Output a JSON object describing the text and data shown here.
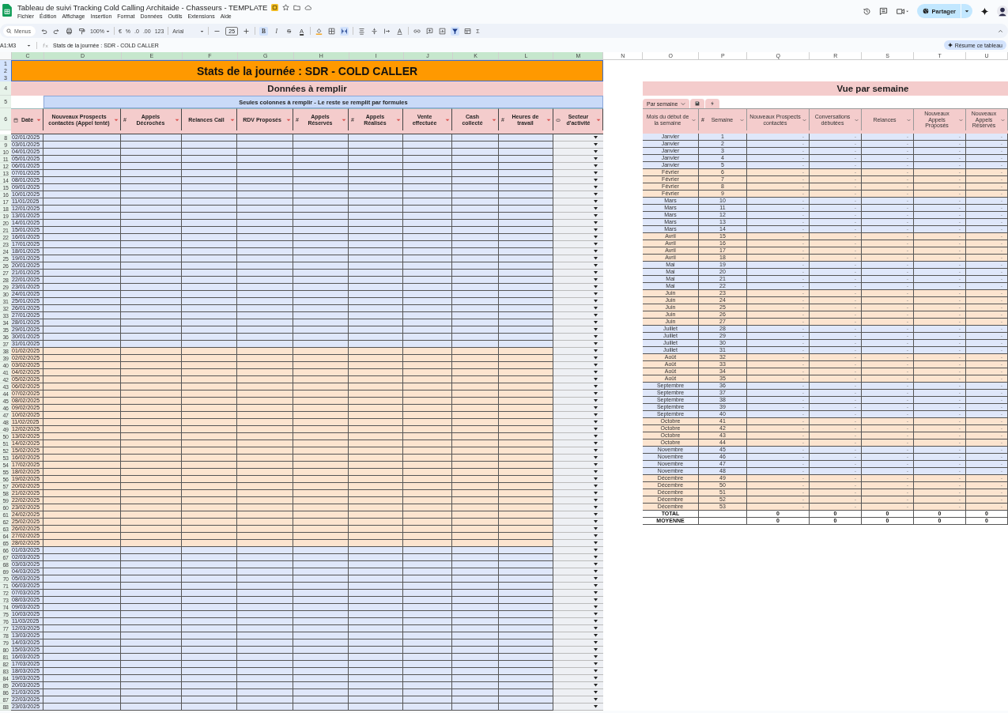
{
  "app": {
    "title": "Tableau de suivi Tracking Cold Calling Architaide - Chasseurs - TEMPLATE",
    "menus": [
      "Fichier",
      "Édition",
      "Affichage",
      "Insertion",
      "Format",
      "Données",
      "Outils",
      "Extensions",
      "Aide"
    ],
    "share": "Partager",
    "ai_button": "Résume ce tableau"
  },
  "toolbar": {
    "search": "Menus",
    "zoom": "100%",
    "currency": "€",
    "percent": "%",
    "decrease_decimals": ".0",
    "increase_decimals": ".00",
    "number_format": "123",
    "font": "Arial",
    "font_size": "25",
    "format_buttons": [
      {
        "label": "B",
        "kind": "bold",
        "on": true
      },
      {
        "label": "I",
        "kind": "italic",
        "on": false
      },
      {
        "label": "S",
        "kind": "strike",
        "on": false
      },
      {
        "label": "A",
        "kind": "color",
        "on": false
      }
    ],
    "merge_on": true,
    "filter_on": true,
    "functions": "Σ"
  },
  "formula_bar": {
    "name_box": "A1:M3",
    "formula": "Stats de la journée : SDR - COLD CALLER"
  },
  "columns": [
    {
      "label": "C",
      "selected": true
    },
    {
      "label": "D",
      "selected": true
    },
    {
      "label": "E",
      "selected": true
    },
    {
      "label": "F",
      "selected": true
    },
    {
      "label": "G",
      "selected": true
    },
    {
      "label": "H",
      "selected": true
    },
    {
      "label": "I",
      "selected": true
    },
    {
      "label": "J",
      "selected": true
    },
    {
      "label": "K",
      "selected": true
    },
    {
      "label": "L",
      "selected": true
    },
    {
      "label": "M",
      "selected": true
    },
    {
      "label": "N",
      "selected": false
    },
    {
      "label": "O",
      "selected": false
    },
    {
      "label": "P",
      "selected": false
    },
    {
      "label": "Q",
      "selected": false
    },
    {
      "label": "R",
      "selected": false
    },
    {
      "label": "S",
      "selected": false
    },
    {
      "label": "T",
      "selected": false
    },
    {
      "label": "U",
      "selected": false
    }
  ],
  "header_rows": [
    {
      "label": "1",
      "selected": true
    },
    {
      "label": "2",
      "selected": true
    },
    {
      "label": "3",
      "selected": true
    },
    {
      "label": "4",
      "selected": false
    },
    {
      "label": "5",
      "selected": false
    },
    {
      "label": "6",
      "selected": false
    }
  ],
  "left": {
    "title": "Stats de la journée : SDR - COLD CALLER",
    "subtitle": "Données à remplir",
    "note": "Seules colonnes à remplir - Le reste se remplit par formules",
    "headers": [
      {
        "label": "Date",
        "kind": "date"
      },
      {
        "label": "Nouveaux Prospects contactés (Appel tenté)",
        "kind": "text"
      },
      {
        "label": "Appels Décrochés",
        "kind": "number",
        "prefix": "#"
      },
      {
        "label": "Relances Call",
        "kind": "text"
      },
      {
        "label": "RDV Proposés",
        "kind": "text"
      },
      {
        "label": "Appels Réservés",
        "kind": "number",
        "prefix": "#"
      },
      {
        "label": "Appels Réalisés",
        "kind": "number",
        "prefix": "#"
      },
      {
        "label": "Vente effectuée",
        "kind": "text"
      },
      {
        "label": "Cash collecté",
        "kind": "text"
      },
      {
        "label": "Heures de travail",
        "kind": "number",
        "prefix": "#"
      },
      {
        "label": "Secteur d'activité",
        "kind": "dropdown"
      }
    ],
    "groups": [
      {
        "color": "#dfe7fa",
        "rows": [
          {
            "row": "8",
            "date": "02/01/2025"
          },
          {
            "row": "9",
            "date": "03/01/2025"
          },
          {
            "row": "10",
            "date": "04/01/2025"
          },
          {
            "row": "11",
            "date": "05/01/2025"
          },
          {
            "row": "12",
            "date": "06/01/2025"
          },
          {
            "row": "13",
            "date": "07/01/2025"
          },
          {
            "row": "14",
            "date": "08/01/2025"
          },
          {
            "row": "15",
            "date": "09/01/2025"
          },
          {
            "row": "16",
            "date": "10/01/2025"
          },
          {
            "row": "17",
            "date": "11/01/2025"
          },
          {
            "row": "18",
            "date": "12/01/2025"
          },
          {
            "row": "19",
            "date": "13/01/2025"
          },
          {
            "row": "20",
            "date": "14/01/2025"
          },
          {
            "row": "21",
            "date": "15/01/2025"
          },
          {
            "row": "22",
            "date": "16/01/2025"
          },
          {
            "row": "23",
            "date": "17/01/2025"
          },
          {
            "row": "24",
            "date": "18/01/2025"
          },
          {
            "row": "25",
            "date": "19/01/2025"
          },
          {
            "row": "26",
            "date": "20/01/2025"
          },
          {
            "row": "27",
            "date": "21/01/2025"
          },
          {
            "row": "28",
            "date": "22/01/2025"
          },
          {
            "row": "29",
            "date": "23/01/2025"
          },
          {
            "row": "30",
            "date": "24/01/2025"
          },
          {
            "row": "31",
            "date": "25/01/2025"
          },
          {
            "row": "32",
            "date": "26/01/2025"
          },
          {
            "row": "33",
            "date": "27/01/2025"
          },
          {
            "row": "34",
            "date": "28/01/2025"
          },
          {
            "row": "35",
            "date": "29/01/2025"
          },
          {
            "row": "36",
            "date": "30/01/2025"
          },
          {
            "row": "37",
            "date": "31/01/2025"
          }
        ]
      },
      {
        "color": "#fce4cf",
        "rows": [
          {
            "row": "38",
            "date": "01/02/2025"
          },
          {
            "row": "39",
            "date": "02/02/2025"
          },
          {
            "row": "40",
            "date": "03/02/2025"
          },
          {
            "row": "41",
            "date": "04/02/2025"
          },
          {
            "row": "42",
            "date": "05/02/2025"
          },
          {
            "row": "43",
            "date": "06/02/2025"
          },
          {
            "row": "44",
            "date": "07/02/2025"
          },
          {
            "row": "45",
            "date": "08/02/2025"
          },
          {
            "row": "46",
            "date": "09/02/2025"
          },
          {
            "row": "47",
            "date": "10/02/2025"
          },
          {
            "row": "48",
            "date": "11/02/2025"
          },
          {
            "row": "49",
            "date": "12/02/2025"
          },
          {
            "row": "50",
            "date": "13/02/2025"
          },
          {
            "row": "51",
            "date": "14/02/2025"
          },
          {
            "row": "52",
            "date": "15/02/2025"
          },
          {
            "row": "53",
            "date": "16/02/2025"
          },
          {
            "row": "54",
            "date": "17/02/2025"
          },
          {
            "row": "55",
            "date": "18/02/2025"
          },
          {
            "row": "56",
            "date": "19/02/2025"
          },
          {
            "row": "57",
            "date": "20/02/2025"
          },
          {
            "row": "58",
            "date": "21/02/2025"
          },
          {
            "row": "59",
            "date": "22/02/2025"
          },
          {
            "row": "60",
            "date": "23/02/2025"
          },
          {
            "row": "61",
            "date": "24/02/2025"
          },
          {
            "row": "62",
            "date": "25/02/2025"
          },
          {
            "row": "63",
            "date": "26/02/2025"
          },
          {
            "row": "64",
            "date": "27/02/2025"
          },
          {
            "row": "65",
            "date": "28/02/2025"
          }
        ]
      },
      {
        "color": "#dfe7fa",
        "rows": [
          {
            "row": "66",
            "date": "01/03/2025"
          },
          {
            "row": "67",
            "date": "02/03/2025"
          },
          {
            "row": "68",
            "date": "03/03/2025"
          },
          {
            "row": "69",
            "date": "04/03/2025"
          },
          {
            "row": "70",
            "date": "05/03/2025"
          },
          {
            "row": "71",
            "date": "06/03/2025"
          },
          {
            "row": "72",
            "date": "07/03/2025"
          },
          {
            "row": "73",
            "date": "08/03/2025"
          },
          {
            "row": "74",
            "date": "09/03/2025"
          },
          {
            "row": "75",
            "date": "10/03/2025"
          },
          {
            "row": "76",
            "date": "11/03/2025"
          },
          {
            "row": "77",
            "date": "12/03/2025"
          },
          {
            "row": "78",
            "date": "13/03/2025"
          },
          {
            "row": "79",
            "date": "14/03/2025"
          },
          {
            "row": "80",
            "date": "15/03/2025"
          },
          {
            "row": "81",
            "date": "16/03/2025"
          },
          {
            "row": "82",
            "date": "17/03/2025"
          },
          {
            "row": "83",
            "date": "18/03/2025"
          },
          {
            "row": "84",
            "date": "19/03/2025"
          },
          {
            "row": "85",
            "date": "20/03/2025"
          },
          {
            "row": "86",
            "date": "21/03/2025"
          },
          {
            "row": "87",
            "date": "22/03/2025"
          },
          {
            "row": "88",
            "date": "23/03/2025"
          }
        ]
      }
    ]
  },
  "right": {
    "title": "Vue par semaine",
    "tab": "Par semaine",
    "headers": [
      {
        "label": "Mois du début de la semaine",
        "kind": "text"
      },
      {
        "label": "Semaine",
        "kind": "number",
        "prefix": "#"
      },
      {
        "label": "Nouveaux Prospects contactés",
        "kind": "text"
      },
      {
        "label": "Conversations débutées",
        "kind": "text"
      },
      {
        "label": "Relances",
        "kind": "text"
      },
      {
        "label": "Nouveaux Appels Proposés",
        "kind": "text"
      },
      {
        "label": "Nouveaux Appels Réservés",
        "kind": "text"
      }
    ],
    "groups": [
      {
        "color": "#dfe7fa",
        "rows": [
          {
            "month": "Janvier",
            "week": "1",
            "values": [
              "-",
              "-",
              "-",
              "-",
              "-"
            ]
          },
          {
            "month": "Janvier",
            "week": "2",
            "values": [
              "-",
              "-",
              "-",
              "-",
              "-"
            ]
          },
          {
            "month": "Janvier",
            "week": "3",
            "values": [
              "-",
              "-",
              "-",
              "-",
              "-"
            ]
          },
          {
            "month": "Janvier",
            "week": "4",
            "values": [
              "-",
              "-",
              "-",
              "-",
              "-"
            ]
          },
          {
            "month": "Janvier",
            "week": "5",
            "values": [
              "-",
              "-",
              "-",
              "-",
              "-"
            ]
          }
        ]
      },
      {
        "color": "#fce4cf",
        "rows": [
          {
            "month": "Février",
            "week": "6",
            "values": [
              "-",
              "-",
              "-",
              "-",
              "-"
            ]
          },
          {
            "month": "Février",
            "week": "7",
            "values": [
              "-",
              "-",
              "-",
              "-",
              "-"
            ]
          },
          {
            "month": "Février",
            "week": "8",
            "values": [
              "-",
              "-",
              "-",
              "-",
              "-"
            ]
          },
          {
            "month": "Février",
            "week": "9",
            "values": [
              "-",
              "-",
              "-",
              "-",
              "-"
            ]
          }
        ]
      },
      {
        "color": "#dfe7fa",
        "rows": [
          {
            "month": "Mars",
            "week": "10",
            "values": [
              "-",
              "-",
              "-",
              "-",
              "-"
            ]
          },
          {
            "month": "Mars",
            "week": "11",
            "values": [
              "-",
              "-",
              "-",
              "-",
              "-"
            ]
          },
          {
            "month": "Mars",
            "week": "12",
            "values": [
              "-",
              "-",
              "-",
              "-",
              "-"
            ]
          },
          {
            "month": "Mars",
            "week": "13",
            "values": [
              "-",
              "-",
              "-",
              "-",
              "-"
            ]
          },
          {
            "month": "Mars",
            "week": "14",
            "values": [
              "-",
              "-",
              "-",
              "-",
              "-"
            ]
          }
        ]
      },
      {
        "color": "#fce4cf",
        "rows": [
          {
            "month": "Avril",
            "week": "15",
            "values": [
              "-",
              "-",
              "-",
              "-",
              "-"
            ]
          },
          {
            "month": "Avril",
            "week": "16",
            "values": [
              "-",
              "-",
              "-",
              "-",
              "-"
            ]
          },
          {
            "month": "Avril",
            "week": "17",
            "values": [
              "-",
              "-",
              "-",
              "-",
              "-"
            ]
          },
          {
            "month": "Avril",
            "week": "18",
            "values": [
              "-",
              "-",
              "-",
              "-",
              "-"
            ]
          }
        ]
      },
      {
        "color": "#dfe7fa",
        "rows": [
          {
            "month": "Mai",
            "week": "19",
            "values": [
              "-",
              "-",
              "-",
              "-",
              "-"
            ]
          },
          {
            "month": "Mai",
            "week": "20",
            "values": [
              "-",
              "-",
              "-",
              "-",
              "-"
            ]
          },
          {
            "month": "Mai",
            "week": "21",
            "values": [
              "-",
              "-",
              "-",
              "-",
              "-"
            ]
          },
          {
            "month": "Mai",
            "week": "22",
            "values": [
              "-",
              "-",
              "-",
              "-",
              "-"
            ]
          }
        ]
      },
      {
        "color": "#fce4cf",
        "rows": [
          {
            "month": "Juin",
            "week": "23",
            "values": [
              "-",
              "-",
              "-",
              "-",
              "-"
            ]
          },
          {
            "month": "Juin",
            "week": "24",
            "values": [
              "-",
              "-",
              "-",
              "-",
              "-"
            ]
          },
          {
            "month": "Juin",
            "week": "25",
            "values": [
              "-",
              "-",
              "-",
              "-",
              "-"
            ]
          },
          {
            "month": "Juin",
            "week": "26",
            "values": [
              "-",
              "-",
              "-",
              "-",
              "-"
            ]
          },
          {
            "month": "Juin",
            "week": "27",
            "values": [
              "-",
              "-",
              "-",
              "-",
              "-"
            ]
          }
        ]
      },
      {
        "color": "#dfe7fa",
        "rows": [
          {
            "month": "Juillet",
            "week": "28",
            "values": [
              "-",
              "-",
              "-",
              "-",
              "-"
            ]
          },
          {
            "month": "Juillet",
            "week": "29",
            "values": [
              "-",
              "-",
              "-",
              "-",
              "-"
            ]
          },
          {
            "month": "Juillet",
            "week": "30",
            "values": [
              "-",
              "-",
              "-",
              "-",
              "-"
            ]
          },
          {
            "month": "Juillet",
            "week": "31",
            "values": [
              "-",
              "-",
              "-",
              "-",
              "-"
            ]
          }
        ]
      },
      {
        "color": "#fce4cf",
        "rows": [
          {
            "month": "Août",
            "week": "32",
            "values": [
              "-",
              "-",
              "-",
              "-",
              "-"
            ]
          },
          {
            "month": "Août",
            "week": "33",
            "values": [
              "-",
              "-",
              "-",
              "-",
              "-"
            ]
          },
          {
            "month": "Août",
            "week": "34",
            "values": [
              "-",
              "-",
              "-",
              "-",
              "-"
            ]
          },
          {
            "month": "Août",
            "week": "35",
            "values": [
              "-",
              "-",
              "-",
              "-",
              "-"
            ]
          }
        ]
      },
      {
        "color": "#dfe7fa",
        "rows": [
          {
            "month": "Septembre",
            "week": "36",
            "values": [
              "-",
              "-",
              "-",
              "-",
              "-"
            ]
          },
          {
            "month": "Septembre",
            "week": "37",
            "values": [
              "-",
              "-",
              "-",
              "-",
              "-"
            ]
          },
          {
            "month": "Septembre",
            "week": "38",
            "values": [
              "-",
              "-",
              "-",
              "-",
              "-"
            ]
          },
          {
            "month": "Septembre",
            "week": "39",
            "values": [
              "-",
              "-",
              "-",
              "-",
              "-"
            ]
          },
          {
            "month": "Septembre",
            "week": "40",
            "values": [
              "-",
              "-",
              "-",
              "-",
              "-"
            ]
          }
        ]
      },
      {
        "color": "#fce4cf",
        "rows": [
          {
            "month": "Octobre",
            "week": "41",
            "values": [
              "-",
              "-",
              "-",
              "-",
              "-"
            ]
          },
          {
            "month": "Octobre",
            "week": "42",
            "values": [
              "-",
              "-",
              "-",
              "-",
              "-"
            ]
          },
          {
            "month": "Octobre",
            "week": "43",
            "values": [
              "-",
              "-",
              "-",
              "-",
              "-"
            ]
          },
          {
            "month": "Octobre",
            "week": "44",
            "values": [
              "-",
              "-",
              "-",
              "-",
              "-"
            ]
          }
        ]
      },
      {
        "color": "#dfe7fa",
        "rows": [
          {
            "month": "Novembre",
            "week": "45",
            "values": [
              "-",
              "-",
              "-",
              "-",
              "-"
            ]
          },
          {
            "month": "Novembre",
            "week": "46",
            "values": [
              "-",
              "-",
              "-",
              "-",
              "-"
            ]
          },
          {
            "month": "Novembre",
            "week": "47",
            "values": [
              "-",
              "-",
              "-",
              "-",
              "-"
            ]
          },
          {
            "month": "Novembre",
            "week": "48",
            "values": [
              "-",
              "-",
              "-",
              "-",
              "-"
            ]
          }
        ]
      },
      {
        "color": "#fce4cf",
        "rows": [
          {
            "month": "Décembre",
            "week": "49",
            "values": [
              "-",
              "-",
              "-",
              "-",
              "-"
            ]
          },
          {
            "month": "Décembre",
            "week": "50",
            "values": [
              "-",
              "-",
              "-",
              "-",
              "-"
            ]
          },
          {
            "month": "Décembre",
            "week": "51",
            "values": [
              "-",
              "-",
              "-",
              "-",
              "-"
            ]
          },
          {
            "month": "Décembre",
            "week": "52",
            "values": [
              "-",
              "-",
              "-",
              "-",
              "-"
            ]
          },
          {
            "month": "Décembre",
            "week": "53",
            "values": [
              "-",
              "-",
              "-",
              "-",
              "-"
            ]
          }
        ]
      }
    ],
    "totals": [
      {
        "label": "TOTAL",
        "values": [
          "0",
          "0",
          "0",
          "0",
          "0"
        ]
      },
      {
        "label": "MOYENNE",
        "values": [
          "0",
          "0",
          "0",
          "0",
          "0"
        ]
      }
    ]
  }
}
